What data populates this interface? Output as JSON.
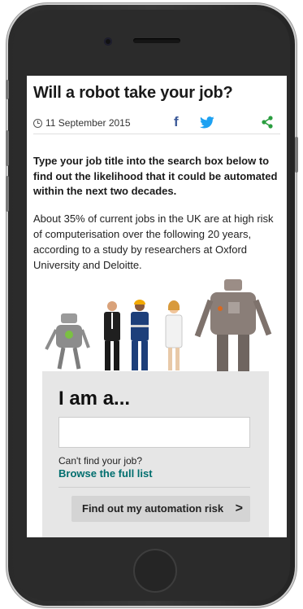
{
  "article": {
    "title": "Will a robot take your job?",
    "date": "11 September 2015",
    "lead": "Type your job title into the search box below to find out the likelihood that it could be automated within the next two decades.",
    "body": "About 35% of current jobs in the UK are at high risk of computerisation over the following 20 years, according to a study by researchers at Oxford University and Deloitte."
  },
  "share": {
    "facebook_glyph": "f",
    "icons": [
      "clock-icon",
      "facebook-icon",
      "twitter-icon",
      "share-icon"
    ]
  },
  "form": {
    "heading": "I am a...",
    "search_value": "",
    "cant_find": "Can't find your job?",
    "browse_link": "Browse the full list",
    "submit_label": "Find out my automation risk",
    "submit_arrow": ">"
  },
  "colors": {
    "facebook": "#3b5998",
    "twitter": "#1da1f2",
    "share": "#2a9d3f",
    "link": "#006e6e",
    "form_bg": "#e6e6e6",
    "button_bg": "#d4d4d4"
  }
}
